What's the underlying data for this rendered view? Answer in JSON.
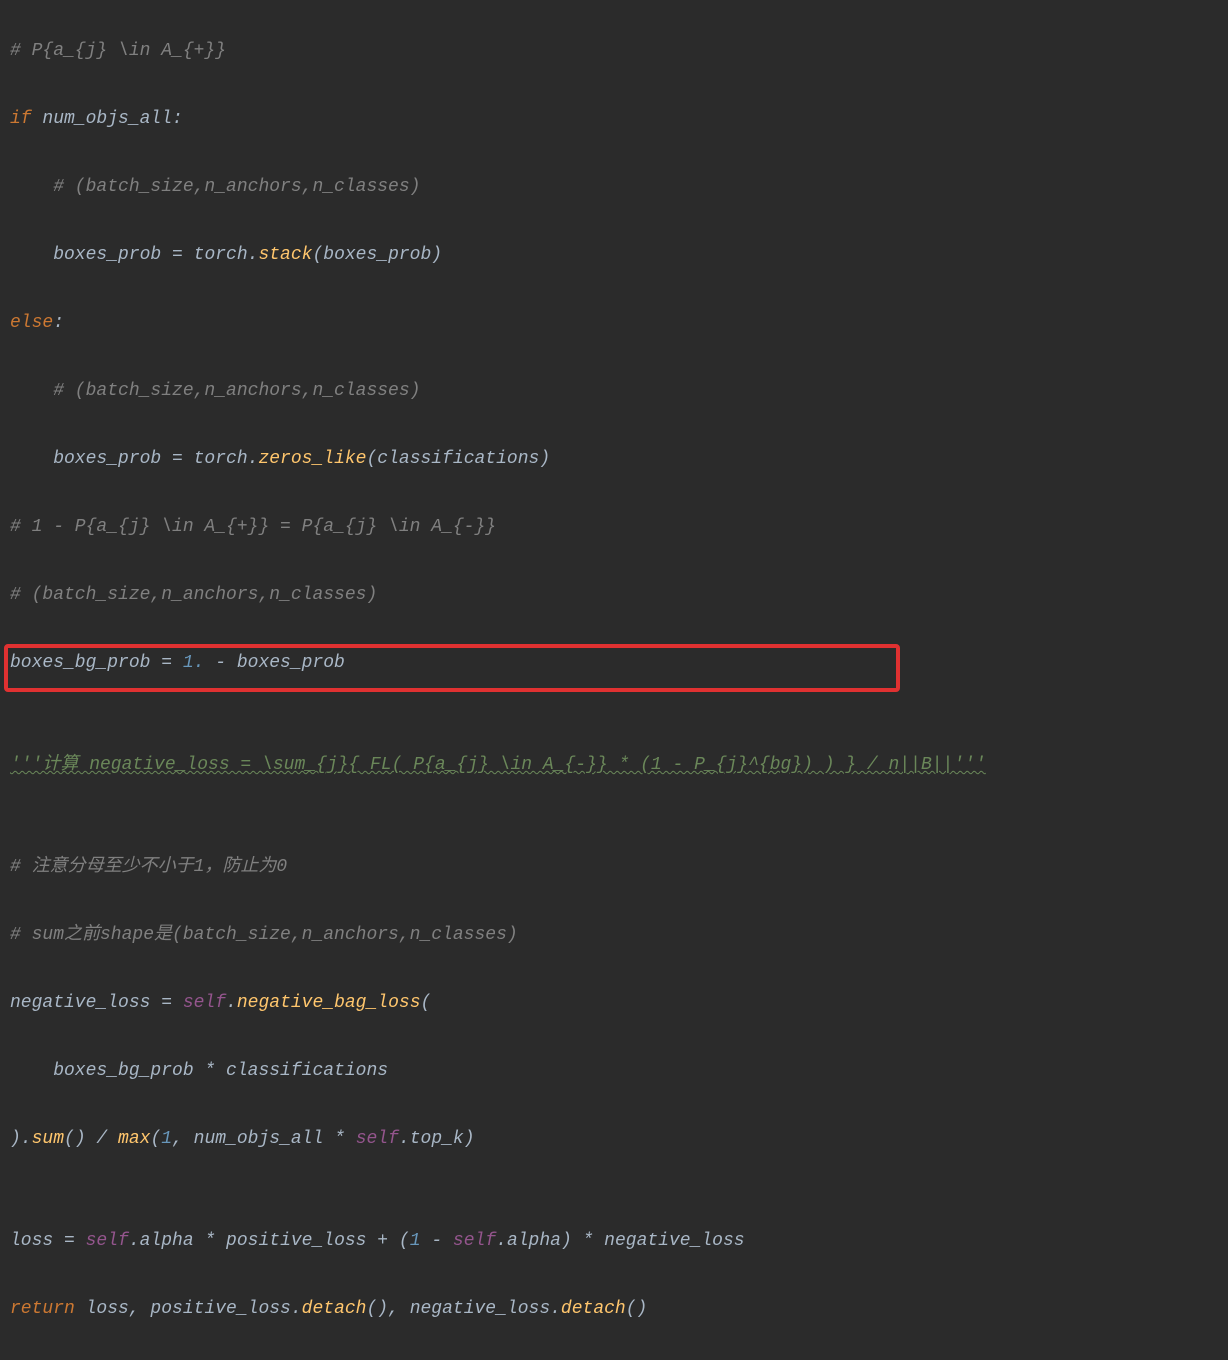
{
  "lines": {
    "l1": {
      "c1": "# P{a_{j} \\in A_{+}}"
    },
    "l2": {
      "kw1": "if ",
      "id1": "num_objs_all:"
    },
    "l3": {
      "c1": "    # (batch_size,n_anchors,n_classes)"
    },
    "l4": {
      "id1": "    boxes_prob ",
      "op1": "= ",
      "id2": "torch.",
      "fn1": "stack",
      "id3": "(boxes_prob)"
    },
    "l5": {
      "kw1": "else",
      "id1": ":"
    },
    "l6": {
      "c1": "    # (batch_size,n_anchors,n_classes)"
    },
    "l7": {
      "id1": "    boxes_prob = torch.",
      "fn1": "zeros_like",
      "id2": "(classifications)"
    },
    "l8": {
      "c1": "# 1 - P{a_{j} \\in A_{+}} = P{a_{j} \\in A_{-}}"
    },
    "l9": {
      "c1": "# (batch_size,n_anchors,n_classes)"
    },
    "l10": {
      "id1": "boxes_bg_prob = ",
      "n1": "1.",
      "id2": " - boxes_prob"
    },
    "l11": {
      "blank": ""
    },
    "l12": {
      "s1": "'''计算 negative_loss = \\sum_{j}{ FL( P{a_{j} \\in A_{-}} * (1 - P_{j}^{bg}) ) } / n||B||'''"
    },
    "l13": {
      "blank": ""
    },
    "l14": {
      "c1": "# 注意分母至少不小于1，防止为0"
    },
    "l15": {
      "c1": "# sum之前shape是(batch_size,n_anchors,n_classes)"
    },
    "l16": {
      "id1": "negative_loss = ",
      "sf1": "self",
      "id2": ".",
      "fn1": "negative_bag_loss",
      "id3": "("
    },
    "l17": {
      "id1": "    boxes_bg_prob * classifications"
    },
    "l18": {
      "id1": ").",
      "fn1": "sum",
      "id2": "() / ",
      "fn2": "max",
      "id3": "(",
      "n1": "1",
      "id4": ", num_objs_all * ",
      "sf1": "self",
      "id5": ".top_k)"
    },
    "l19": {
      "blank": ""
    },
    "l20": {
      "id1": "loss = ",
      "sf1": "self",
      "id2": ".alpha * positive_loss + (",
      "n1": "1",
      "id3": " - ",
      "sf2": "self",
      "id4": ".alpha) * negative_loss"
    },
    "l21": {
      "kw1": "return ",
      "id1": "loss, positive_loss.",
      "fn1": "detach",
      "id2": "(), negative_loss.",
      "fn2": "detach",
      "id3": "()"
    }
  }
}
